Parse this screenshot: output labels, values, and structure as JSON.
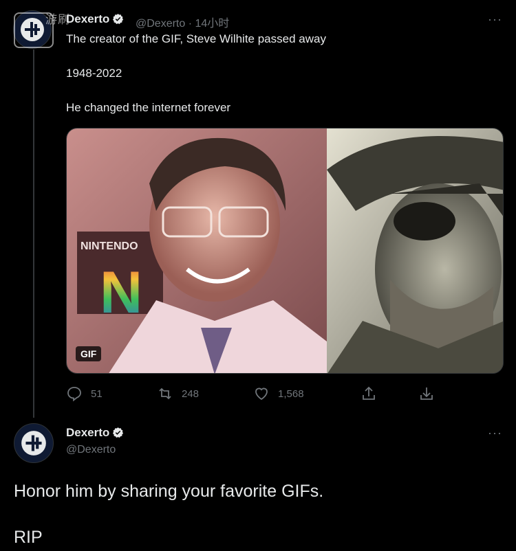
{
  "thread": {
    "parent": {
      "author_name": "Dexerto",
      "author_handle": "@Dexerto",
      "time_separator": "·",
      "time": "14小时",
      "text_lines": [
        "The creator of the GIF, Steve Wilhite passed away",
        "1948-2022",
        "He changed the internet forever"
      ],
      "media": {
        "badge": "GIF",
        "left_image_logo_text": "NINTENDO",
        "left_image_logo_letter": "N"
      },
      "actions": {
        "reply_count": "51",
        "retweet_count": "248",
        "like_count": "1,568"
      },
      "more_label": "···"
    },
    "reply": {
      "author_name": "Dexerto",
      "author_handle": "@Dexerto",
      "text_lines": [
        "Honor him by sharing your favorite GIFs.",
        "RIP"
      ],
      "more_label": "···"
    }
  },
  "watermark": {
    "text": "游刷"
  },
  "colors": {
    "background": "#000000",
    "text_primary": "#e7e9ea",
    "text_secondary": "#71767b",
    "verified": "#e7e9ea",
    "divider": "#2f3336"
  },
  "icons": [
    "reply-icon",
    "retweet-icon",
    "like-icon",
    "share-icon",
    "download-icon",
    "verified-icon",
    "more-icon"
  ]
}
